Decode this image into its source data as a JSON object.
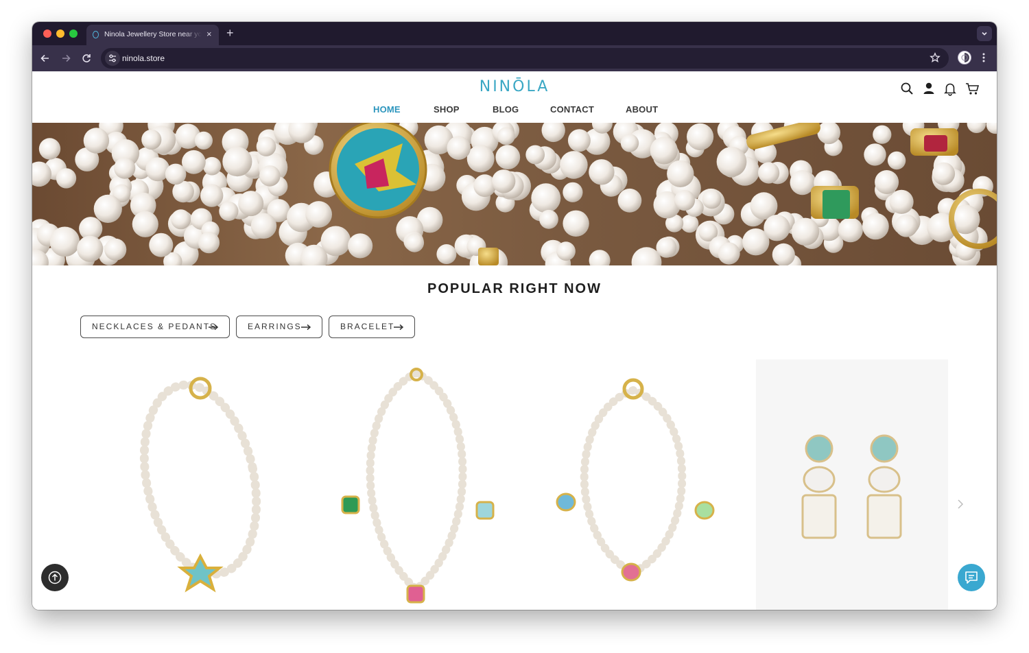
{
  "browser": {
    "tab_title": "Ninola Jewellery Store near you",
    "url": "ninola.store",
    "new_tab": "+",
    "tab_close": "×"
  },
  "site": {
    "logo": "NINŌLA",
    "nav": [
      {
        "label": "HOME",
        "active": true
      },
      {
        "label": "SHOP",
        "active": false
      },
      {
        "label": "BLOG",
        "active": false
      },
      {
        "label": "CONTACT",
        "active": false
      },
      {
        "label": "ABOUT",
        "active": false
      }
    ],
    "header_icons": [
      "search-icon",
      "user-icon",
      "bell-icon",
      "cart-icon"
    ]
  },
  "popular": {
    "title": "POPULAR RIGHT NOW",
    "categories": [
      "NECKLACES & PEDANTS",
      "EARRINGS",
      "BRACELET"
    ],
    "products": [
      {
        "kind": "pearl-necklace-star-charm"
      },
      {
        "kind": "pearl-necklace-three-gems"
      },
      {
        "kind": "pearl-necklace-turtle-charms"
      },
      {
        "kind": "crystal-drop-earrings"
      }
    ]
  },
  "colors": {
    "accent": "#3aa7c4",
    "nav_active": "#2b95bd",
    "chrome_dark": "#201a2e",
    "chrome_toolbar": "#38314a",
    "chat_button": "#3aa8d0"
  }
}
